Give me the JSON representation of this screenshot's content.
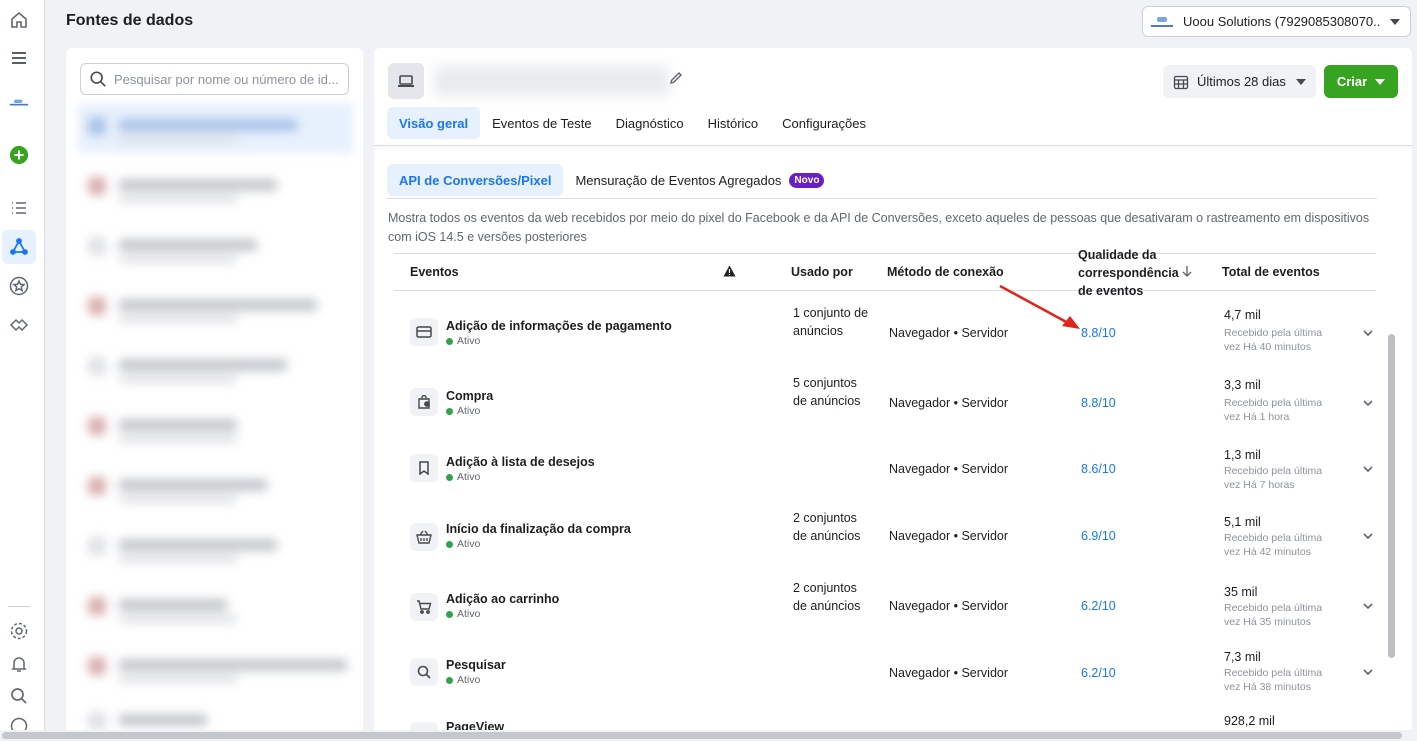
{
  "header": {
    "title": "Fontes de dados"
  },
  "account": {
    "name": "Uoou Solutions (7929085308070..."
  },
  "rail": {
    "icons": [
      "home-icon",
      "menu-icon",
      "brand-logo",
      "add-icon",
      "list-icon",
      "data-sources-icon",
      "star-icon",
      "partner-icon",
      "settings-icon",
      "notifications-icon",
      "search-icon",
      "help-icon"
    ]
  },
  "list_panel": {
    "search_placeholder": "Pesquisar por nome ou número de id..."
  },
  "toolbar": {
    "date_range": "Últimos 28 dias",
    "create_label": "Criar"
  },
  "tabs": [
    "Visão geral",
    "Eventos de Teste",
    "Diagnóstico",
    "Histórico",
    "Configurações"
  ],
  "subtabs": {
    "api": "API de Conversões/Pixel",
    "aggregated": "Mensuração de Eventos Agregados",
    "badge": "Novo"
  },
  "description": "Mostra todos os eventos da web recebidos por meio do pixel do Facebook e da API de Conversões, exceto aqueles de pessoas que desativaram o rastreamento em dispositivos com iOS 14.5 e versões posteriores",
  "table": {
    "headers": {
      "events": "Eventos",
      "used_by": "Usado por",
      "method": "Método de conexão",
      "quality": "Qualidade da correspondência de eventos",
      "total": "Total de eventos"
    },
    "rows": [
      {
        "name": "Adição de informações de pagamento",
        "status": "Ativo",
        "used_by": "1 conjunto de anúncios",
        "method": "Navegador • Servidor",
        "quality": "8.8/10",
        "total": "4,7 mil",
        "last": "Recebido pela última vez Há 40 minutos",
        "icon": "card-icon"
      },
      {
        "name": "Compra",
        "status": "Ativo",
        "used_by": "5 conjuntos de anúncios",
        "method": "Navegador • Servidor",
        "quality": "8.8/10",
        "total": "3,3 mil",
        "last": "Recebido pela última vez Há 1 hora",
        "icon": "bag-icon"
      },
      {
        "name": "Adição à lista de desejos",
        "status": "Ativo",
        "used_by": "",
        "method": "Navegador • Servidor",
        "quality": "8.6/10",
        "total": "1,3 mil",
        "last": "Recebido pela última vez Há 7 horas",
        "icon": "bookmark-icon"
      },
      {
        "name": "Início da finalização da compra",
        "status": "Ativo",
        "used_by": "2 conjuntos de anúncios",
        "method": "Navegador • Servidor",
        "quality": "6.9/10",
        "total": "5,1 mil",
        "last": "Recebido pela última vez Há 42 minutos",
        "icon": "basket-icon"
      },
      {
        "name": "Adição ao carrinho",
        "status": "Ativo",
        "used_by": "2 conjuntos de anúncios",
        "method": "Navegador • Servidor",
        "quality": "6.2/10",
        "total": "35 mil",
        "last": "Recebido pela última vez Há 35 minutos",
        "icon": "cart-icon"
      },
      {
        "name": "Pesquisar",
        "status": "Ativo",
        "used_by": "",
        "method": "Navegador • Servidor",
        "quality": "6.2/10",
        "total": "7,3 mil",
        "last": "Recebido pela última vez Há 38 minutos",
        "icon": "search-icon"
      },
      {
        "name": "PageView",
        "status": "",
        "used_by": "",
        "method": "",
        "quality": "",
        "total": "928,2 mil",
        "last": "",
        "icon": "page-icon"
      }
    ]
  },
  "colors": {
    "accent": "#1877f2",
    "create": "#36a420",
    "active_dot": "#31a24c",
    "badge": "#6a1fc5",
    "annotation_arrow": "#e0241b"
  }
}
